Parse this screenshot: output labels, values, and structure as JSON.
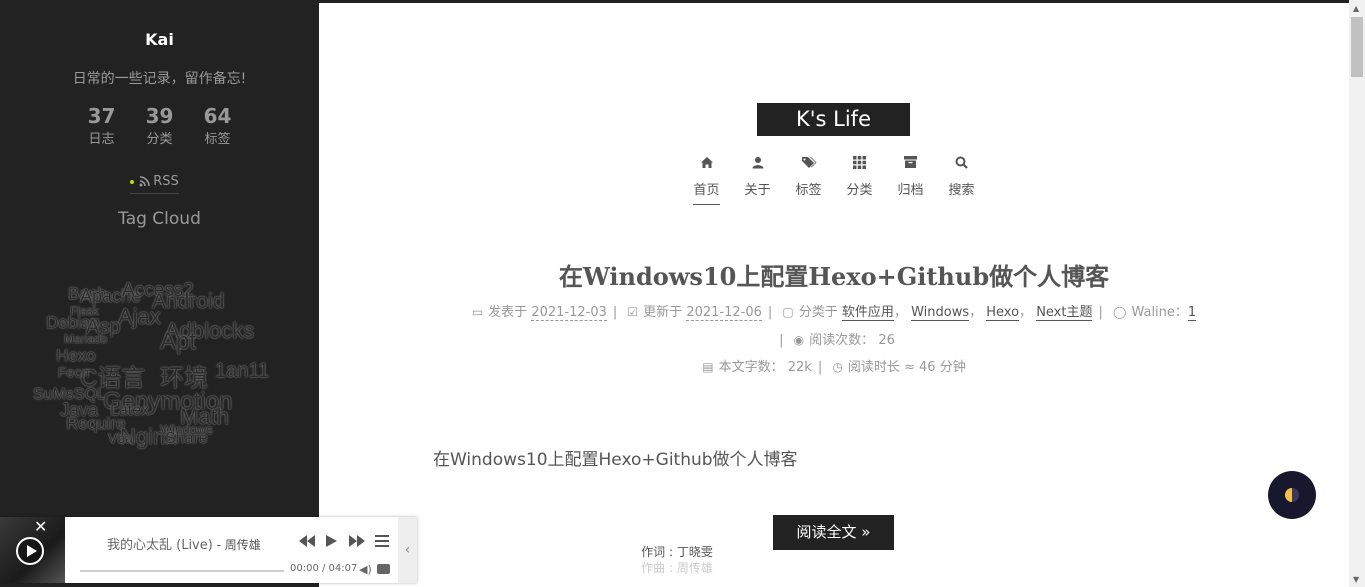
{
  "sidebar": {
    "author_name": "Kai",
    "description": "日常的一些记录，留作备忘!",
    "stats": [
      {
        "count": "37",
        "label": "日志"
      },
      {
        "count": "39",
        "label": "分类"
      },
      {
        "count": "64",
        "label": "标签"
      }
    ],
    "rss_label": "RSS",
    "tag_cloud_title": "Tag Cloud",
    "tags": [
      "Bash",
      "Apache",
      "Access2",
      "Android",
      "Flask",
      "Ajax",
      "Debian",
      "Asp",
      "Adblocks",
      "Mariadb",
      "Apt",
      "Hexo",
      "C语言",
      "环境",
      "1an11",
      "Fecn",
      "SuMsSQL",
      "Genymotion",
      "Java",
      "Latex",
      "Math",
      "Require",
      "Nginx",
      "Windows",
      "Vba",
      "Share"
    ]
  },
  "header": {
    "site_title": "K's Life",
    "menu": [
      {
        "label": "首页",
        "icon": "home-icon",
        "active": true
      },
      {
        "label": "关于",
        "icon": "user-icon",
        "active": false
      },
      {
        "label": "标签",
        "icon": "tags-icon",
        "active": false
      },
      {
        "label": "分类",
        "icon": "th-icon",
        "active": false
      },
      {
        "label": "归档",
        "icon": "archive-icon",
        "active": false
      },
      {
        "label": "搜索",
        "icon": "search-icon",
        "active": false
      }
    ]
  },
  "post": {
    "title": "在Windows10上配置Hexo+Github做个人博客",
    "posted_label": "发表于",
    "posted_date": "2021-12-03",
    "updated_label": "更新于",
    "updated_date": "2021-12-06",
    "category_label": "分类于",
    "categories": [
      "软件应用",
      "Windows",
      "Hexo",
      "Next主题"
    ],
    "comments_label": "Waline：",
    "comments_count": "1",
    "views_label": "阅读次数：",
    "views_count": "26",
    "wordcount_label": "本文字数：",
    "wordcount": "22k",
    "readtime_label": "阅读时长 ≈",
    "readtime": "46 分钟",
    "excerpt": "在Windows10上配置Hexo+Github做个人博客",
    "read_more": "阅读全文 »"
  },
  "player": {
    "song_title": "我的心太乱 (Live)",
    "artist": " - 周传雄",
    "time": "00:00 / 04:07",
    "progress": 0.0,
    "lyrics": [
      "作词 : 丁晓雯",
      "作曲 : 周传雄"
    ]
  },
  "colors": {
    "sidebar_bg": "#222222",
    "accent": "#222222",
    "theme_toggle": "#17172e"
  }
}
